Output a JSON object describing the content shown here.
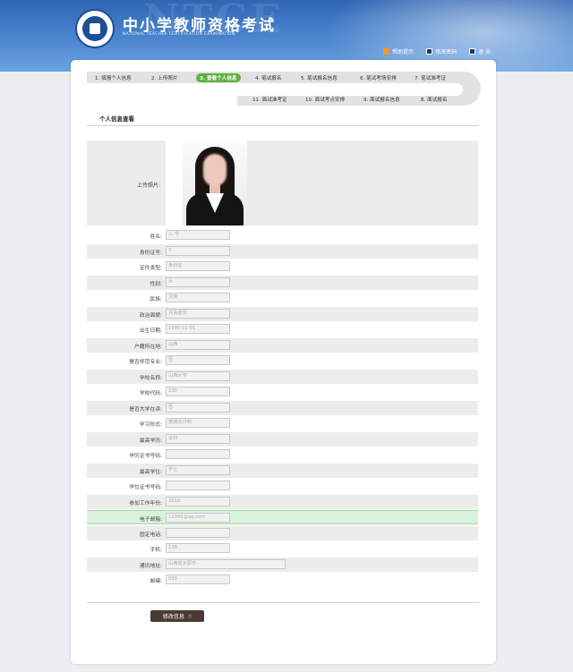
{
  "header": {
    "title": "中小学教师资格考试",
    "subtitle": "NATIONAL TEACHER CERTIFICATION EXAMINATION",
    "links": [
      {
        "label": "帮助提示",
        "icon": "help-icon"
      },
      {
        "label": "修改密码",
        "icon": "key-icon"
      },
      {
        "label": "退 出",
        "icon": "exit-icon"
      }
    ]
  },
  "steps": [
    {
      "label": "1. 填报个人信息"
    },
    {
      "label": "2. 上传照片"
    },
    {
      "label": "3. 查看个人信息",
      "active": true
    },
    {
      "label": "4. 笔试报名"
    },
    {
      "label": "5. 笔试报名信息"
    },
    {
      "label": "6. 笔试考场安排"
    },
    {
      "label": "7. 笔试准考证"
    },
    {
      "label": "11. 面试准考证"
    },
    {
      "label": "10. 面试考点安排"
    },
    {
      "label": "9. 面试报名信息"
    },
    {
      "label": "8. 面试报名"
    }
  ],
  "section": {
    "title": "个人信息查看"
  },
  "photo": {
    "label": "上传照片:"
  },
  "fields": [
    {
      "label": "姓名:",
      "value": "三 号"
    },
    {
      "label": "身份证号:",
      "value": "3"
    },
    {
      "label": "证件类型:",
      "value": "身份证"
    },
    {
      "label": "性别:",
      "value": "女"
    },
    {
      "label": "民族:",
      "value": "汉族"
    },
    {
      "label": "政治面貌:",
      "value": "共青团员"
    },
    {
      "label": "出生日期:",
      "value": "1990-01-01"
    },
    {
      "label": "户籍所在地:",
      "value": "山西"
    },
    {
      "label": "是否师范专业:",
      "value": "否"
    },
    {
      "label": "学校名称:",
      "value": "山西大学"
    },
    {
      "label": "学校代码:",
      "value": "100"
    },
    {
      "label": "是否大学在读:",
      "value": "否"
    },
    {
      "label": "学习形式:",
      "value": "普通全日制"
    },
    {
      "label": "最高学历:",
      "value": "本科"
    },
    {
      "label": "学历证书号码:",
      "value": ""
    },
    {
      "label": "最高学位:",
      "value": "学士"
    },
    {
      "label": "学位证书号码:",
      "value": ""
    },
    {
      "label": "参加工作年份:",
      "value": "2018"
    },
    {
      "label": "电子邮箱:",
      "value": "12345@qq.com"
    },
    {
      "label": "固定电话:",
      "value": ""
    },
    {
      "label": "手机:",
      "value": "138"
    },
    {
      "label": "通讯地址:",
      "value": "山西省太原市"
    },
    {
      "label": "邮编:",
      "value": "030"
    }
  ],
  "actions": {
    "edit_label": "修改信息"
  }
}
